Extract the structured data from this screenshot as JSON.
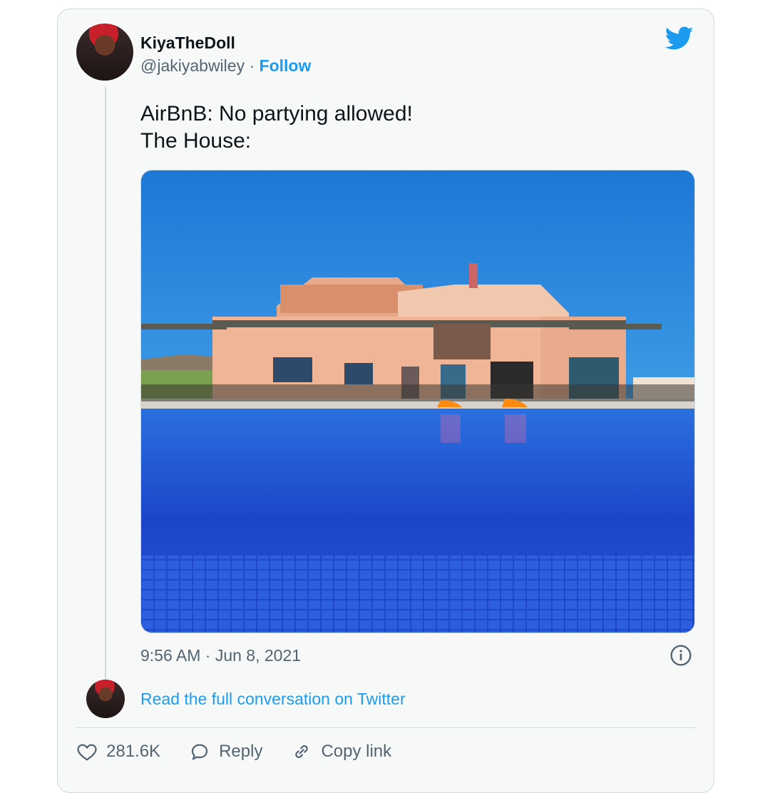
{
  "tweet": {
    "author": {
      "display_name": "KiyaTheDoll",
      "handle": "@jakiyabwiley",
      "separator": "·",
      "follow_label": "Follow"
    },
    "text_lines": [
      "AirBnB: No partying allowed!",
      "The House:"
    ],
    "timestamp": "9:56 AM · Jun 8, 2021",
    "read_full_label": "Read the full conversation on Twitter",
    "actions": {
      "likes": "281.6K",
      "reply_label": "Reply",
      "copy_link_label": "Copy link"
    }
  },
  "icons": {
    "brand": "twitter-bird-icon",
    "info": "info-icon",
    "like": "heart-icon",
    "reply": "speech-bubble-icon",
    "copy": "link-icon"
  },
  "colors": {
    "accent": "#1d9bf0",
    "text": "#0f1419",
    "muted": "#536471",
    "card_bg": "#f7f9f9"
  }
}
